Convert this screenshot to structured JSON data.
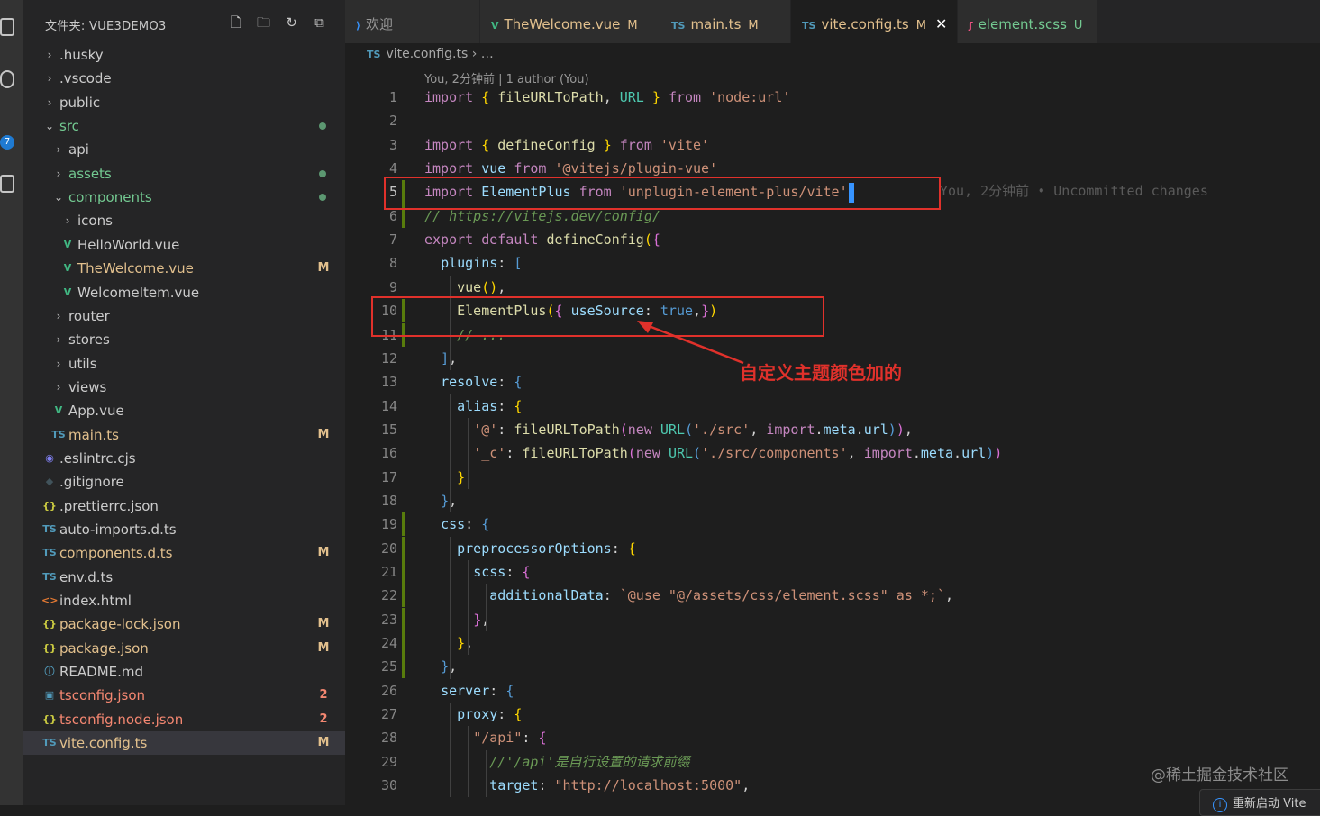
{
  "sidebar": {
    "title": "文件夹: VUE3DEMO3",
    "badge": "7",
    "items": [
      {
        "label": "husky",
        "prefix": ".",
        "kind": "folder",
        "chev": "›",
        "color": "#cccccc"
      },
      {
        "label": ".vscode",
        "kind": "folder",
        "chev": "›",
        "color": "#cccccc"
      },
      {
        "label": "public",
        "kind": "folder",
        "chev": "›",
        "color": "#cccccc"
      },
      {
        "label": "src",
        "kind": "folder-open",
        "chev": "⌄",
        "color": "#73c991",
        "dot": true
      },
      {
        "label": "api",
        "kind": "folder",
        "chev": "›",
        "color": "#cccccc"
      },
      {
        "label": "assets",
        "kind": "folder",
        "chev": "›",
        "color": "#73c991",
        "dot": true
      },
      {
        "label": "components",
        "kind": "folder-open",
        "chev": "⌄",
        "color": "#73c991",
        "dot": true
      },
      {
        "label": "icons",
        "kind": "folder",
        "chev": "›",
        "color": "#cccccc"
      },
      {
        "label": "HelloWorld.vue",
        "kind": "vue",
        "color": "#cccccc"
      },
      {
        "label": "TheWelcome.vue",
        "kind": "vue",
        "color": "#e2c08d",
        "dec": "M"
      },
      {
        "label": "WelcomeItem.vue",
        "kind": "vue",
        "color": "#cccccc"
      },
      {
        "label": "router",
        "kind": "folder",
        "chev": "›",
        "color": "#cccccc"
      },
      {
        "label": "stores",
        "kind": "folder",
        "chev": "›",
        "color": "#cccccc"
      },
      {
        "label": "utils",
        "kind": "folder",
        "chev": "›",
        "color": "#cccccc"
      },
      {
        "label": "views",
        "kind": "folder",
        "chev": "›",
        "color": "#cccccc"
      },
      {
        "label": "App.vue",
        "kind": "vue",
        "color": "#cccccc"
      },
      {
        "label": "main.ts",
        "kind": "ts",
        "color": "#e2c08d",
        "dec": "M"
      },
      {
        "label": ".eslintrc.cjs",
        "kind": "eslint",
        "color": "#cccccc"
      },
      {
        "label": ".gitignore",
        "kind": "git",
        "color": "#cccccc"
      },
      {
        "label": ".prettierrc.json",
        "kind": "json",
        "color": "#cccccc"
      },
      {
        "label": "auto-imports.d.ts",
        "kind": "ts",
        "color": "#cccccc"
      },
      {
        "label": "components.d.ts",
        "kind": "ts",
        "color": "#e2c08d",
        "dec": "M"
      },
      {
        "label": "env.d.ts",
        "kind": "ts",
        "color": "#cccccc"
      },
      {
        "label": "index.html",
        "kind": "html",
        "color": "#cccccc"
      },
      {
        "label": "package-lock.json",
        "kind": "json",
        "color": "#e2c08d",
        "dec": "M"
      },
      {
        "label": "package.json",
        "kind": "json",
        "color": "#e2c08d",
        "dec": "M"
      },
      {
        "label": "README.md",
        "kind": "info",
        "color": "#cccccc"
      },
      {
        "label": "tsconfig.json",
        "kind": "tsconfig",
        "color": "#f48771",
        "dec": "2",
        "decColor": "#f48771"
      },
      {
        "label": "tsconfig.node.json",
        "kind": "json",
        "color": "#f48771",
        "dec": "2",
        "decColor": "#f48771"
      },
      {
        "label": "vite.config.ts",
        "kind": "ts",
        "color": "#e2c08d",
        "dec": "M",
        "selected": true
      }
    ]
  },
  "tabs": [
    {
      "icon": "vscode",
      "label": "欢迎",
      "mod": ""
    },
    {
      "icon": "vue",
      "label": "TheWelcome.vue",
      "mod": "M"
    },
    {
      "icon": "ts",
      "label": "main.ts",
      "mod": "M"
    },
    {
      "icon": "ts",
      "label": "vite.config.ts",
      "mod": "M",
      "active": true,
      "close": "✕"
    },
    {
      "icon": "scss",
      "label": "element.scss",
      "mod": "U"
    }
  ],
  "breadcrumb": {
    "icon": "TS",
    "file": "vite.config.ts",
    "rest": "…"
  },
  "blame_top": "You, 2分钟前 | 1 author (You)",
  "inline_blame": "You, 2分钟前 • Uncommitted changes",
  "annotation": "自定义主题颜色加的",
  "watermark": "@稀土掘金技术社区",
  "notification": "重新启动 Vite",
  "code": [
    [
      [
        "k",
        "import"
      ],
      [
        "g",
        " "
      ],
      [
        "y",
        "{"
      ],
      [
        "g",
        " "
      ],
      [
        "f",
        "fileURLToPath"
      ],
      [
        "g",
        ", "
      ],
      [
        "t",
        "URL"
      ],
      [
        "g",
        " "
      ],
      [
        "y",
        "}"
      ],
      [
        "g",
        " "
      ],
      [
        "k",
        "from"
      ],
      [
        "g",
        " "
      ],
      [
        "s",
        "'node:url'"
      ]
    ],
    [],
    [
      [
        "k",
        "import"
      ],
      [
        "g",
        " "
      ],
      [
        "y",
        "{"
      ],
      [
        "g",
        " "
      ],
      [
        "f",
        "defineConfig"
      ],
      [
        "g",
        " "
      ],
      [
        "y",
        "}"
      ],
      [
        "g",
        " "
      ],
      [
        "k",
        "from"
      ],
      [
        "g",
        " "
      ],
      [
        "s",
        "'vite'"
      ]
    ],
    [
      [
        "k",
        "import"
      ],
      [
        "g",
        " "
      ],
      [
        "p",
        "vue"
      ],
      [
        "g",
        " "
      ],
      [
        "k",
        "from"
      ],
      [
        "g",
        " "
      ],
      [
        "s",
        "'@vitejs/plugin-vue'"
      ]
    ],
    [
      [
        "k",
        "import"
      ],
      [
        "g",
        " "
      ],
      [
        "p",
        "ElementPlus"
      ],
      [
        "g",
        " "
      ],
      [
        "k",
        "from"
      ],
      [
        "g",
        " "
      ],
      [
        "s",
        "'unplugin-element-plus/vite'"
      ]
    ],
    [
      [
        "c",
        "// https://vitejs.dev/config/"
      ]
    ],
    [
      [
        "k",
        "export"
      ],
      [
        "g",
        " "
      ],
      [
        "k",
        "default"
      ],
      [
        "g",
        " "
      ],
      [
        "f",
        "defineConfig"
      ],
      [
        "y",
        "("
      ],
      [
        "pk",
        "{"
      ]
    ],
    [
      [
        "g",
        "  "
      ],
      [
        "p",
        "plugins"
      ],
      [
        "g",
        ": "
      ],
      [
        "b",
        "["
      ]
    ],
    [
      [
        "g",
        "    "
      ],
      [
        "f",
        "vue"
      ],
      [
        "y",
        "()"
      ],
      [
        "g",
        ","
      ]
    ],
    [
      [
        "g",
        "    "
      ],
      [
        "f",
        "ElementPlus"
      ],
      [
        "y",
        "("
      ],
      [
        "pk",
        "{"
      ],
      [
        "g",
        " "
      ],
      [
        "p",
        "useSource"
      ],
      [
        "g",
        ": "
      ],
      [
        "b",
        "true"
      ],
      [
        "g",
        ","
      ],
      [
        "pk",
        "}"
      ],
      [
        "y",
        ")"
      ]
    ],
    [
      [
        "g",
        "    "
      ],
      [
        "c",
        "// ..."
      ]
    ],
    [
      [
        "g",
        "  "
      ],
      [
        "b",
        "]"
      ],
      [
        "g",
        ","
      ]
    ],
    [
      [
        "g",
        "  "
      ],
      [
        "p",
        "resolve"
      ],
      [
        "g",
        ": "
      ],
      [
        "b",
        "{"
      ]
    ],
    [
      [
        "g",
        "    "
      ],
      [
        "p",
        "alias"
      ],
      [
        "g",
        ": "
      ],
      [
        "y",
        "{"
      ]
    ],
    [
      [
        "g",
        "      "
      ],
      [
        "s",
        "'@'"
      ],
      [
        "g",
        ": "
      ],
      [
        "f",
        "fileURLToPath"
      ],
      [
        "pk",
        "("
      ],
      [
        "k",
        "new"
      ],
      [
        "g",
        " "
      ],
      [
        "t",
        "URL"
      ],
      [
        "b",
        "("
      ],
      [
        "s",
        "'./src'"
      ],
      [
        "g",
        ", "
      ],
      [
        "k",
        "import"
      ],
      [
        "g",
        "."
      ],
      [
        "p",
        "meta"
      ],
      [
        "g",
        "."
      ],
      [
        "p",
        "url"
      ],
      [
        "b",
        ")"
      ],
      [
        "pk",
        ")"
      ],
      [
        "g",
        ","
      ]
    ],
    [
      [
        "g",
        "      "
      ],
      [
        "s",
        "'_c'"
      ],
      [
        "g",
        ": "
      ],
      [
        "f",
        "fileURLToPath"
      ],
      [
        "pk",
        "("
      ],
      [
        "k",
        "new"
      ],
      [
        "g",
        " "
      ],
      [
        "t",
        "URL"
      ],
      [
        "b",
        "("
      ],
      [
        "s",
        "'./src/components'"
      ],
      [
        "g",
        ", "
      ],
      [
        "k",
        "import"
      ],
      [
        "g",
        "."
      ],
      [
        "p",
        "meta"
      ],
      [
        "g",
        "."
      ],
      [
        "p",
        "url"
      ],
      [
        "b",
        ")"
      ],
      [
        "pk",
        ")"
      ]
    ],
    [
      [
        "g",
        "    "
      ],
      [
        "y",
        "}"
      ]
    ],
    [
      [
        "g",
        "  "
      ],
      [
        "b",
        "}"
      ],
      [
        "g",
        ","
      ]
    ],
    [
      [
        "g",
        "  "
      ],
      [
        "p",
        "css"
      ],
      [
        "g",
        ": "
      ],
      [
        "b",
        "{"
      ]
    ],
    [
      [
        "g",
        "    "
      ],
      [
        "p",
        "preprocessorOptions"
      ],
      [
        "g",
        ": "
      ],
      [
        "y",
        "{"
      ]
    ],
    [
      [
        "g",
        "      "
      ],
      [
        "p",
        "scss"
      ],
      [
        "g",
        ": "
      ],
      [
        "pk",
        "{"
      ]
    ],
    [
      [
        "g",
        "        "
      ],
      [
        "p",
        "additionalData"
      ],
      [
        "g",
        ": "
      ],
      [
        "s",
        "`@use \"@/assets/css/element.scss\" as *;`"
      ],
      [
        "g",
        ","
      ]
    ],
    [
      [
        "g",
        "      "
      ],
      [
        "pk",
        "}"
      ],
      [
        "g",
        ","
      ]
    ],
    [
      [
        "g",
        "    "
      ],
      [
        "y",
        "}"
      ],
      [
        "g",
        ","
      ]
    ],
    [
      [
        "g",
        "  "
      ],
      [
        "b",
        "}"
      ],
      [
        "g",
        ","
      ]
    ],
    [
      [
        "g",
        "  "
      ],
      [
        "p",
        "server"
      ],
      [
        "g",
        ": "
      ],
      [
        "b",
        "{"
      ]
    ],
    [
      [
        "g",
        "    "
      ],
      [
        "p",
        "proxy"
      ],
      [
        "g",
        ": "
      ],
      [
        "y",
        "{"
      ]
    ],
    [
      [
        "g",
        "      "
      ],
      [
        "s",
        "\"/api\""
      ],
      [
        "g",
        ": "
      ],
      [
        "pk",
        "{"
      ]
    ],
    [
      [
        "g",
        "        "
      ],
      [
        "c",
        "//'/api'是自行设置的请求前缀"
      ]
    ],
    [
      [
        "g",
        "        "
      ],
      [
        "p",
        "target"
      ],
      [
        "g",
        ": "
      ],
      [
        "s",
        "\"http://localhost:5000\""
      ],
      [
        "g",
        ","
      ]
    ]
  ],
  "current_line": 5,
  "gutter_modified_lines": [
    5,
    6,
    10,
    11,
    19,
    20,
    21,
    22,
    23,
    24,
    25
  ]
}
